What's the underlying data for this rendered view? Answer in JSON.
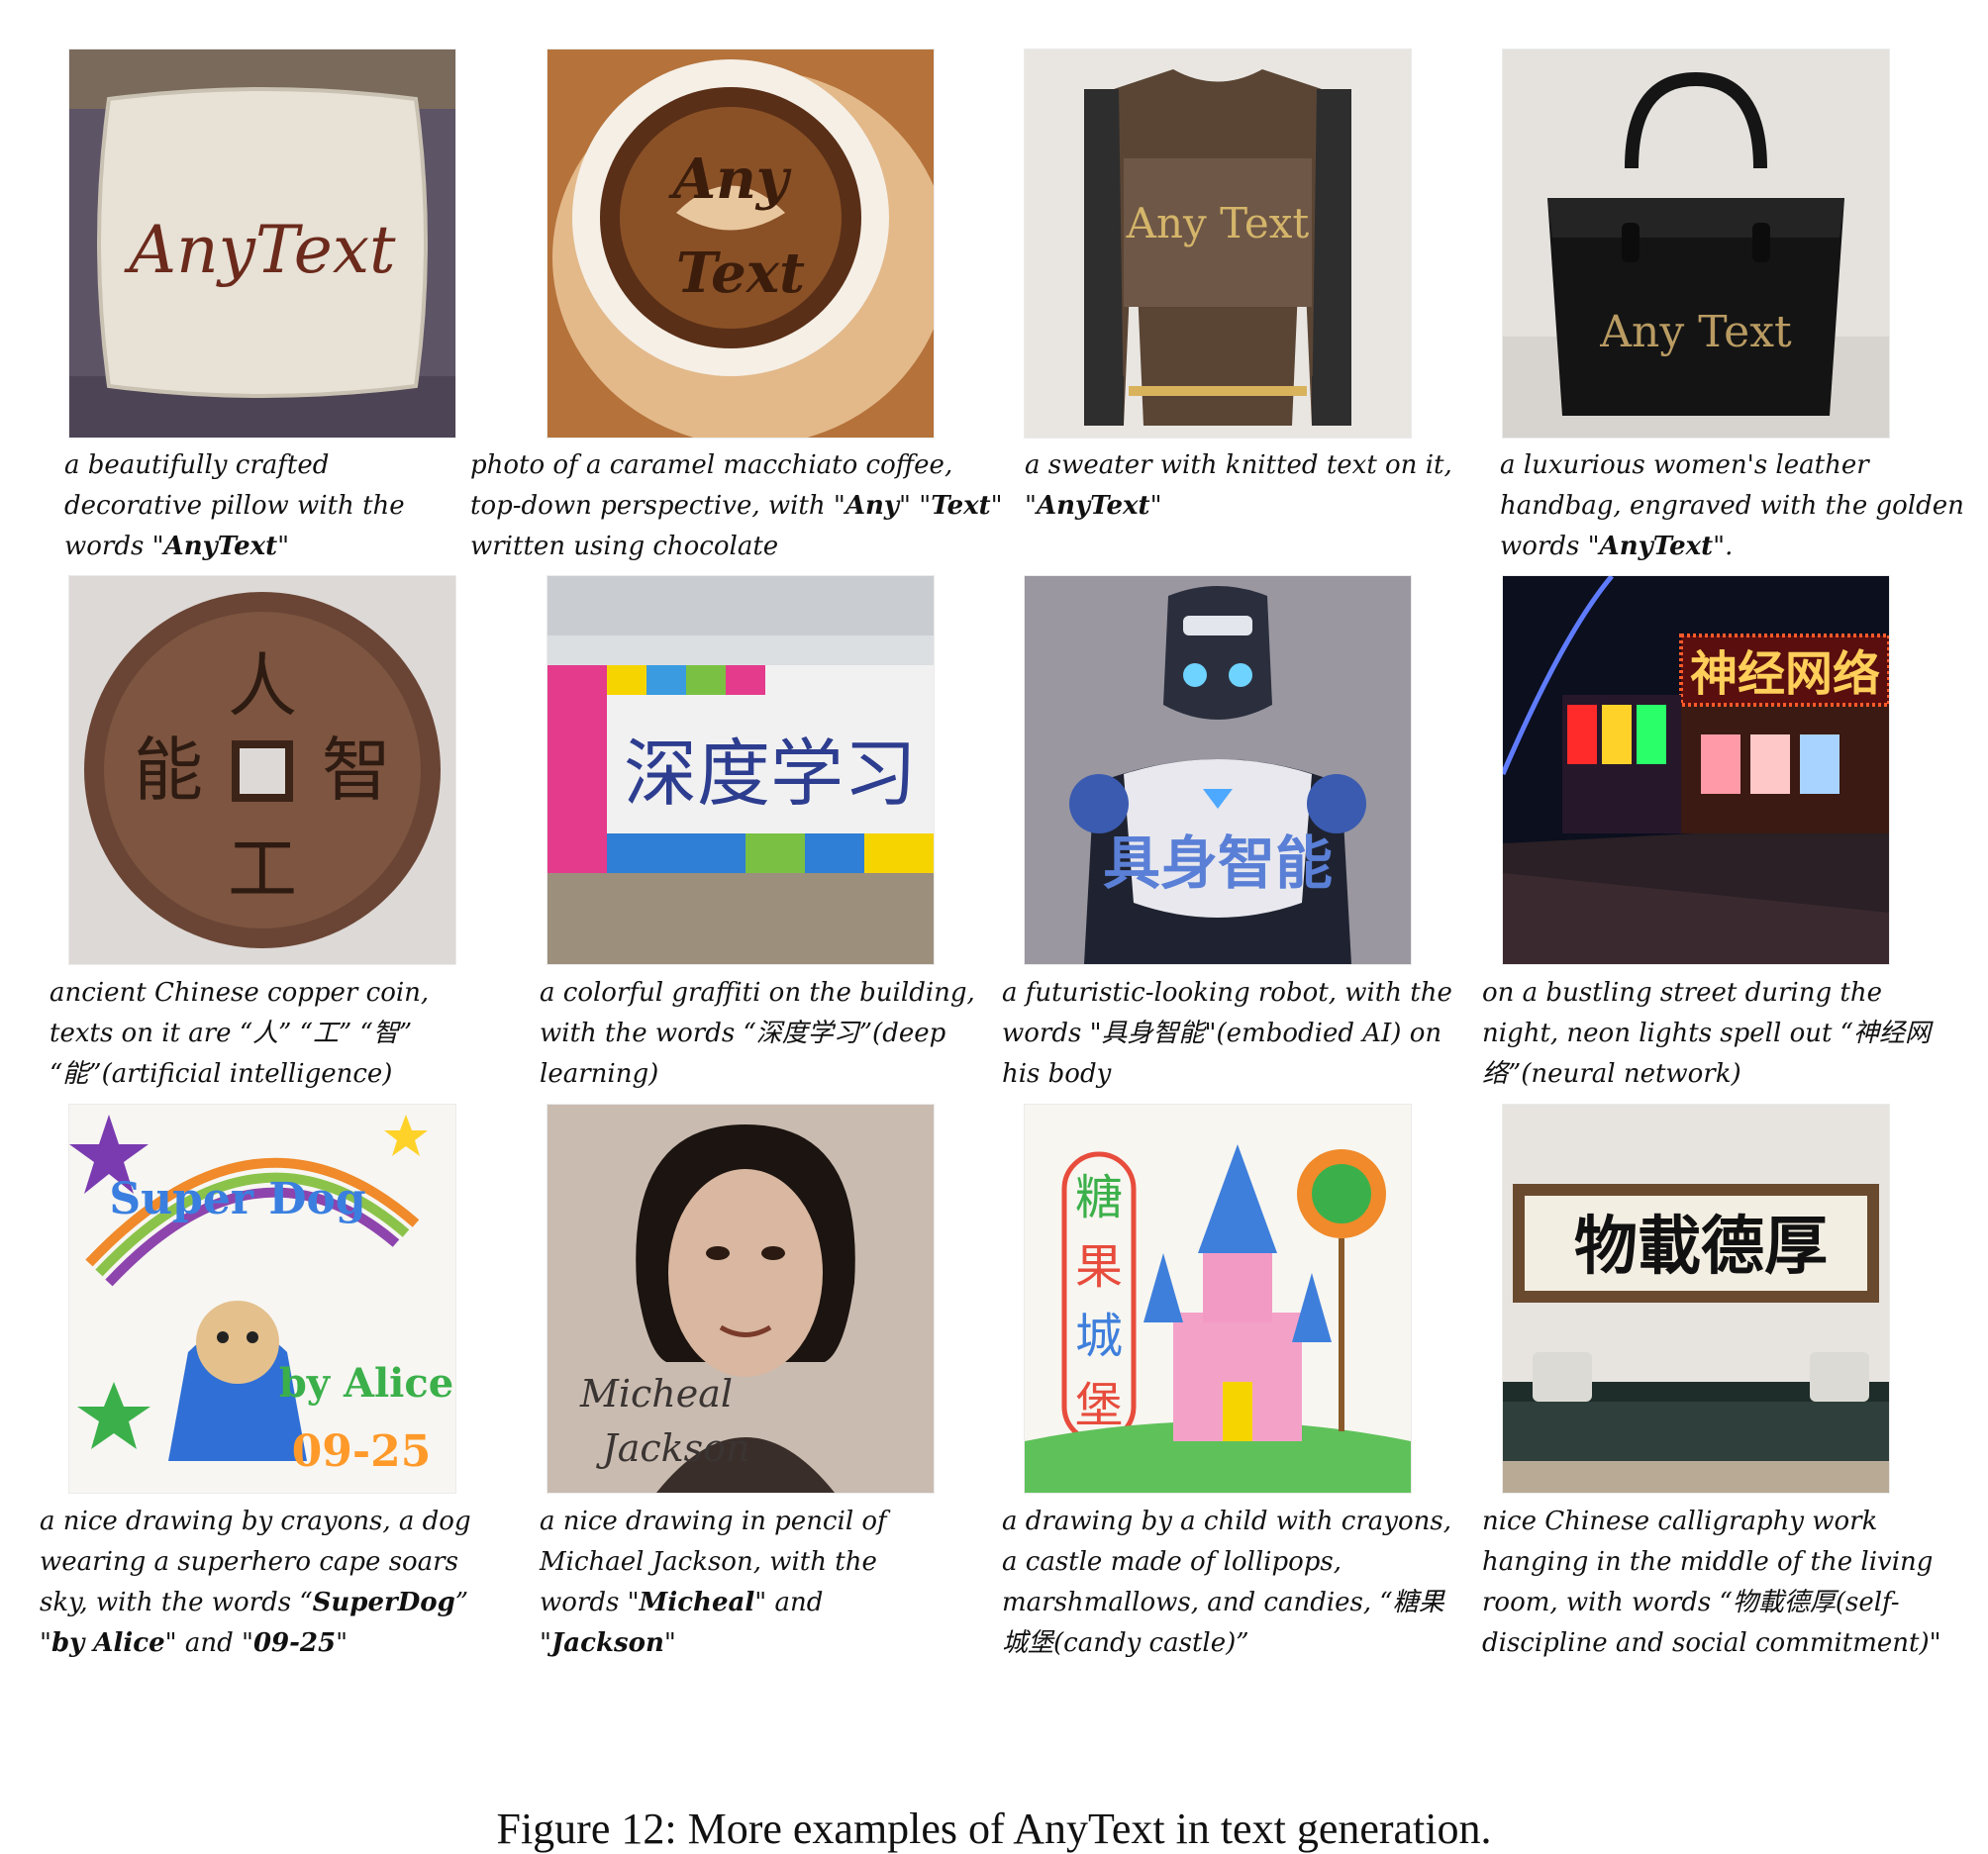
{
  "figure": {
    "caption": "Figure 12: More examples of AnyText in text generation."
  },
  "panels": [
    {
      "rendered_text": "AnyText",
      "caption": {
        "pre": "a beautifully crafted decorative pillow with the words \"",
        "bold": "AnyText",
        "post": "\""
      }
    },
    {
      "rendered_text": "Any Text",
      "caption": {
        "pre": "photo of a caramel macchiato coffee, top-down perspective, with \"",
        "bold": "Any",
        "mid": "\" \"",
        "bold2": "Text",
        "post": "\" written using chocolate"
      }
    },
    {
      "rendered_text": "Any Text",
      "caption": {
        "pre": "a sweater with knitted text on it, \"",
        "bold": "AnyText",
        "post": "\""
      }
    },
    {
      "rendered_text": "Any Text",
      "caption": {
        "pre": "a luxurious women's leather handbag, engraved with the golden words \"",
        "bold": "AnyText",
        "post": "\"."
      }
    },
    {
      "rendered_text": [
        "人",
        "工",
        "智",
        "能"
      ],
      "caption": {
        "pre": "ancient Chinese copper coin, texts on it are “人” “工” “智” “能”(artificial intelligence)"
      }
    },
    {
      "rendered_text": "深度学习",
      "caption": {
        "pre": "a colorful graffiti on the building, with the words “深度学习”(deep learning)"
      }
    },
    {
      "rendered_text": "具身智能",
      "caption": {
        "pre": "a futuristic-looking robot, with the words \"具身智能\"(embodied AI) on his body"
      }
    },
    {
      "rendered_text": "神经网络",
      "caption": {
        "pre": "on a bustling street during the night, neon lights spell out “神经网络”(neural network)"
      }
    },
    {
      "rendered_text": [
        "Super Dog",
        "by Alice",
        "09-25"
      ],
      "caption": {
        "pre": "a nice drawing by crayons, a dog wearing a superhero cape soars sky, with the words “",
        "bold": "SuperDog",
        "mid": "” \"",
        "bold2": "by Alice",
        "mid2": "\" and \"",
        "bold3": "09-25",
        "post": "\""
      }
    },
    {
      "rendered_text": [
        "Micheal",
        "Jackson"
      ],
      "caption": {
        "pre": "a nice drawing in pencil of Michael Jackson, with the words \"",
        "bold": "Micheal",
        "mid": "\" and \"",
        "bold2": "Jackson",
        "post": "\""
      }
    },
    {
      "rendered_text": [
        "糖",
        "果",
        "城",
        "堡"
      ],
      "caption": {
        "pre": "a drawing by a child with crayons, a castle made of lollipops, marshmallows, and candies, “糖果城堡(candy castle)”"
      }
    },
    {
      "rendered_text": "物載德厚",
      "caption": {
        "pre": "nice Chinese calligraphy work hanging in the middle of the living room, with words “物載德厚(self-discipline and social commitment)\""
      }
    }
  ]
}
